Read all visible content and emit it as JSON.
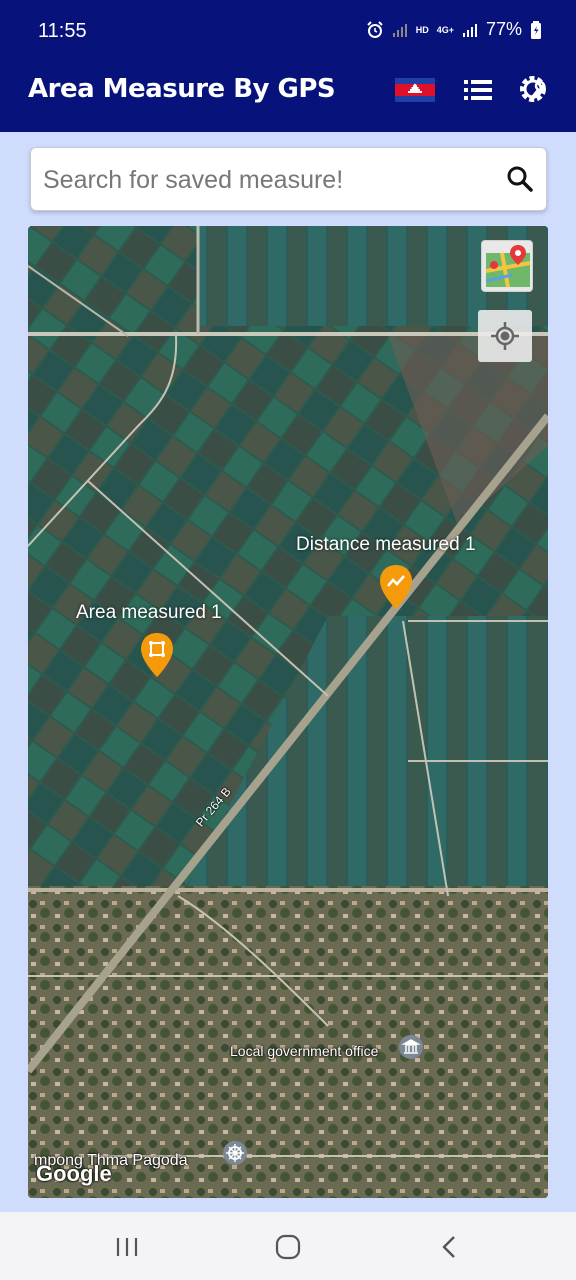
{
  "status_bar": {
    "time": "11:55",
    "network_label": "HD",
    "network_type": "4G+",
    "battery": "77%",
    "icons": [
      "alarm-icon",
      "signal-icon",
      "battery-icon"
    ]
  },
  "app_bar": {
    "title": "Area Measure By GPS",
    "flag": "cambodia-flag",
    "icons": [
      "list-icon",
      "settings-icon"
    ]
  },
  "search": {
    "placeholder": "Search for saved measure!",
    "value": "",
    "icon": "search-icon"
  },
  "map": {
    "markers": [
      {
        "label": "Distance measured 1",
        "type": "distance",
        "color": "#f59b0b"
      },
      {
        "label": "Area measured 1",
        "type": "area",
        "color": "#f59b0b"
      }
    ],
    "labels": {
      "road": "Pr 264 B",
      "poi_1": "Local government office",
      "poi_2": "mpong Thma Pagoda"
    },
    "attribution": "Google",
    "controls": [
      "map-type-icon",
      "my-location-icon"
    ]
  },
  "nav_bar": {
    "icons": [
      "recent-apps-icon",
      "home-icon",
      "back-icon"
    ]
  },
  "colors": {
    "app_bar": "#07137a",
    "background": "#cfdcfb",
    "marker": "#f59b0b"
  }
}
